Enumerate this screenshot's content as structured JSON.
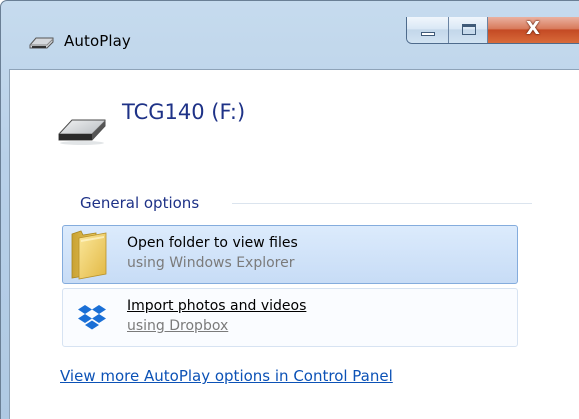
{
  "window": {
    "title": "AutoPlay",
    "title_icon": "drive-icon",
    "close_glyph": "X"
  },
  "device": {
    "name": "TCG140 (F:)",
    "icon": "removable-drive-icon"
  },
  "general_options": {
    "label": "General options",
    "items": [
      {
        "title": "Open folder to view files",
        "subtitle": "using Windows Explorer",
        "icon": "folder-icon",
        "state": "selected"
      },
      {
        "title": "Import photos and videos",
        "subtitle": "using Dropbox",
        "icon": "dropbox-icon",
        "state": "hover"
      }
    ]
  },
  "footer": {
    "link_text": "View more AutoPlay options in Control Panel"
  },
  "colors": {
    "accent_text": "#1e3287",
    "link": "#0c52b6",
    "close_button": "#c44a24"
  }
}
